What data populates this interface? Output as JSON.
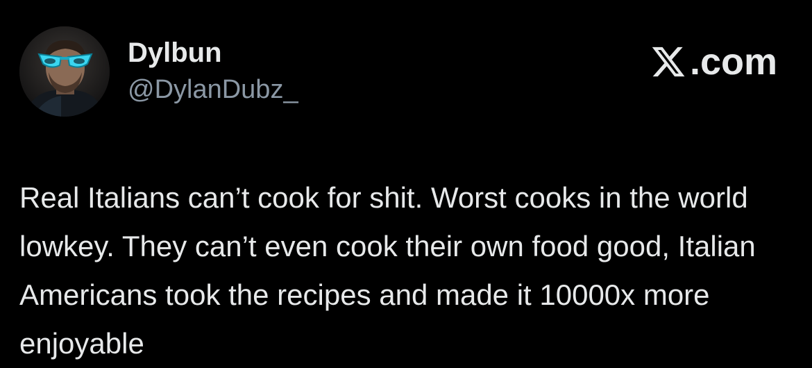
{
  "post": {
    "author": {
      "display_name": "Dylbun",
      "handle": "@DylanDubz_",
      "avatar_icon": "avatar-portrait-with-blue-sunglasses"
    },
    "brand": {
      "icon": "x-logo-icon",
      "text": ".com"
    },
    "text": "Real Italians can’t cook for shit. Worst cooks in the world lowkey. They can’t even cook their own food good, Italian Americans took the recipes and made it 10000x more enjoyable"
  },
  "colors": {
    "background": "#000000",
    "primary_text": "#e7e9ea",
    "secondary_text": "#8b98a5",
    "avatar_glasses": "#3ad6f0"
  }
}
